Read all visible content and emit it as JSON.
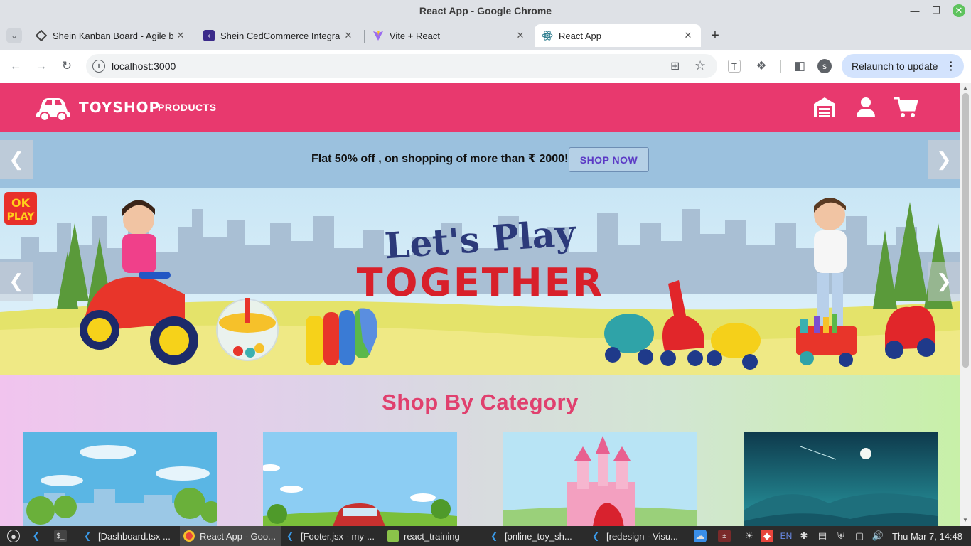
{
  "window": {
    "title": "React App - Google Chrome"
  },
  "tabs": [
    {
      "label": "Shein Kanban Board - Agile b",
      "active": false
    },
    {
      "label": "Shein CedCommerce Integra",
      "active": false
    },
    {
      "label": "Vite + React",
      "active": false
    },
    {
      "label": "React App",
      "active": true
    }
  ],
  "toolbar": {
    "url": "localhost:3000",
    "relaunch_label": "Relaunch to update",
    "profile_initial": "s"
  },
  "site": {
    "brand": "TOYSHOP",
    "nav": {
      "products": "PRODUCTS"
    },
    "promo": {
      "text": "Flat 50% off , on shopping of more than ₹ 2000!",
      "cta": "SHOP NOW"
    },
    "banner": {
      "line1": "Let's Play",
      "line2": "TOGETHER",
      "badge_line1": "OK",
      "badge_line2": "PLAY"
    },
    "category": {
      "title": "Shop By Category"
    },
    "colors": {
      "primary": "#e8396e",
      "promo_bg": "#9bc1de",
      "cta_text": "#5b39c5",
      "title": "#e0406e"
    }
  },
  "taskbar": {
    "items": [
      {
        "label": "[Dashboard.tsx ...",
        "icon": "vscode-icon"
      },
      {
        "label": "React App - Goo...",
        "icon": "chrome-icon"
      },
      {
        "label": "[Footer.jsx - my-...",
        "icon": "vscode-icon"
      },
      {
        "label": "react_training",
        "icon": "folder-icon"
      },
      {
        "label": "[online_toy_sh...",
        "icon": "vscode-icon"
      },
      {
        "label": "[redesign - Visu...",
        "icon": "vscode-icon"
      }
    ],
    "language": "EN",
    "clock": "Thu Mar 7, 14:48"
  }
}
